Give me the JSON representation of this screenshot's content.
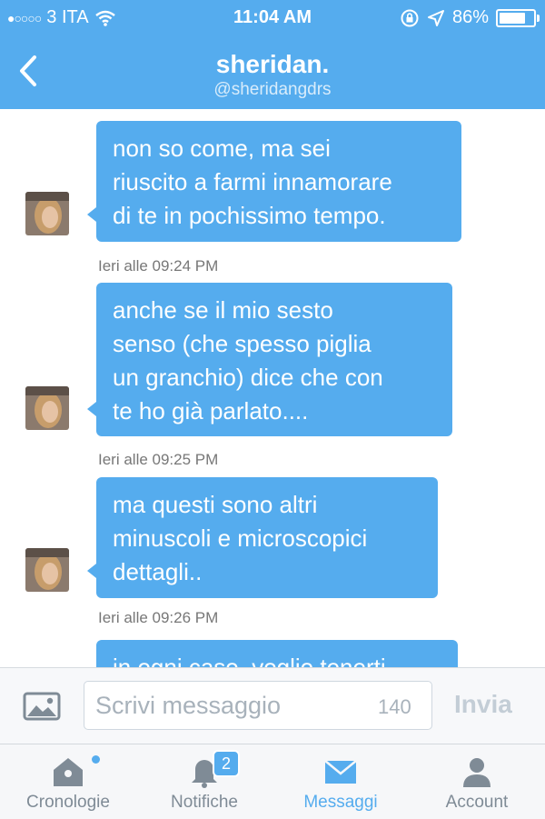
{
  "status_bar": {
    "signal_dots": "●○○○○",
    "carrier": "3 ITA",
    "time": "11:04 AM",
    "battery_percent": "86%",
    "battery_level": 0.86
  },
  "header": {
    "back_icon": "chevron-left-icon",
    "title": "sheridan.",
    "handle": "@sheridangdrs"
  },
  "messages": [
    {
      "text": "non so come, ma sei\nriuscito a farmi innamorare\ndi te in pochissimo tempo.",
      "time": "Ieri alle 09:24 PM"
    },
    {
      "text": "anche se il mio sesto\nsenso (che spesso piglia\nun granchio) dice che con\nte ho già parlato....",
      "time": "Ieri alle 09:25 PM"
    },
    {
      "text": "ma questi sono altri\nminuscoli e microscopici\ndettagli..",
      "time": "Ieri alle 09:26 PM"
    },
    {
      "text": "in ogni caso, voglio tenerti",
      "time": ""
    }
  ],
  "composer": {
    "placeholder": "Scrivi messaggio",
    "counter": "140",
    "send_label": "Invia"
  },
  "tabs": [
    {
      "label": "Cronologie",
      "icon": "home-icon",
      "active": false
    },
    {
      "label": "Notifiche",
      "icon": "bell-icon",
      "badge": "2",
      "active": false
    },
    {
      "label": "Messaggi",
      "icon": "envelope-icon",
      "active": true
    },
    {
      "label": "Account",
      "icon": "person-icon",
      "active": false
    }
  ],
  "colors": {
    "accent": "#55acee",
    "inactive_tab": "#7f8b96",
    "timestamp": "#777777"
  }
}
